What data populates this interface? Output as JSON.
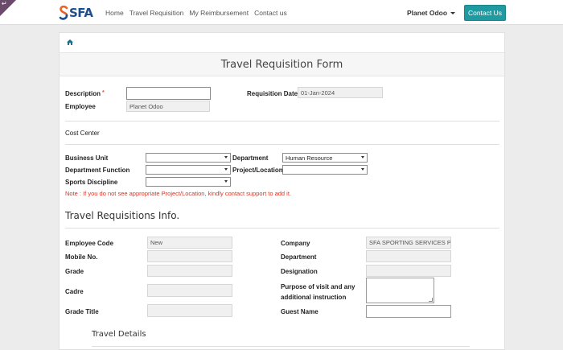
{
  "nav": {
    "brand": "SFA",
    "links": [
      "Home",
      "Travel Requisition",
      "My Reimbursement",
      "Contact us"
    ],
    "user": "Planet Odoo",
    "contact_button": "Contact Us"
  },
  "form": {
    "title": "Travel Requisition Form",
    "description_label": "Description",
    "description_value": "",
    "employee_label": "Employee",
    "employee_value": "Planet Odoo",
    "requisition_date_label": "Requisition Date",
    "requisition_date_value": "01-Jan-2024",
    "cost_center_label": "Cost Center",
    "business_unit_label": "Business Unit",
    "business_unit_value": "",
    "department_label": "Department",
    "department_value": "Human Resource",
    "department_function_label": "Department Function",
    "department_function_value": "",
    "project_location_label": "Project/Location",
    "project_location_value": "",
    "sports_discipline_label": "Sports Discipline",
    "sports_discipline_value": "",
    "note": "Note : If you do not see appropriate Project/Location, kindly contact support to add it."
  },
  "info": {
    "title": "Travel Requisitions Info.",
    "employee_code_label": "Employee Code",
    "employee_code_value": "New",
    "mobile_label": "Mobile No.",
    "mobile_value": "",
    "grade_label": "Grade",
    "grade_value": "",
    "cadre_label": "Cadre",
    "cadre_value": "",
    "grade_title_label": "Grade Title",
    "grade_title_value": "",
    "company_label": "Company",
    "company_value": "SFA SPORTING SERVICES PRI",
    "department_label": "Department",
    "department_value": "",
    "designation_label": "Designation",
    "designation_value": "",
    "purpose_label_line1": "Purpose of visit and any",
    "purpose_label_line2": "additional instruction",
    "purpose_value": "",
    "guest_name_label": "Guest Name",
    "guest_name_value": ""
  },
  "travel_details": {
    "title": "Travel Details"
  },
  "colors": {
    "accent": "#1f9aa0",
    "brand_blue": "#1f4e8c",
    "note_red": "#e0301e"
  },
  "icons": {
    "breadcrumb": "home-icon",
    "corner": "debug-corner-icon"
  }
}
